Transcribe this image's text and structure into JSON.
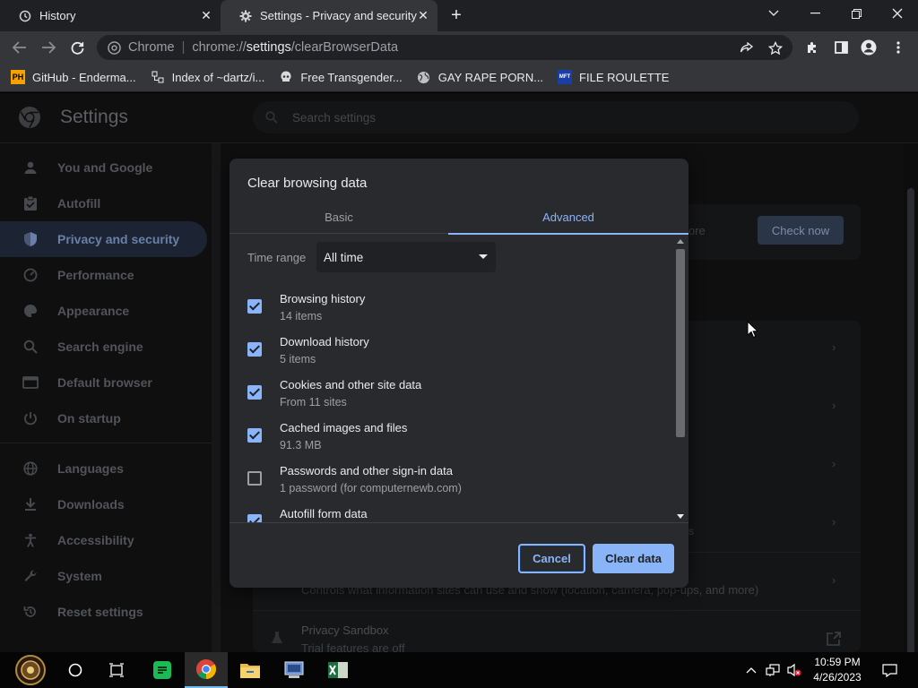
{
  "tabs": [
    {
      "title": "History",
      "icon": "history-icon"
    },
    {
      "title": "Settings - Privacy and security",
      "icon": "gear-icon"
    }
  ],
  "toolbar": {
    "site_chip": "Chrome",
    "url_scheme": "chrome://",
    "url_host": "settings",
    "url_path": "/clearBrowserData"
  },
  "bookmarks": [
    {
      "label": "GitHub - Enderma...",
      "icon": "ph-icon",
      "icon_text": "PH"
    },
    {
      "label": "Index of ~dartz/i...",
      "icon": "folder-index-icon"
    },
    {
      "label": "Free Transgender...",
      "icon": "skull-icon"
    },
    {
      "label": "GAY RAPE PORN...",
      "icon": "globe-icon"
    },
    {
      "label": "FILE ROULETTE",
      "icon": "mft-icon",
      "icon_text": "MFT"
    }
  ],
  "settings": {
    "title": "Settings",
    "search_placeholder": "Search settings",
    "sidebar": [
      {
        "label": "You and Google",
        "icon": "person-icon"
      },
      {
        "label": "Autofill",
        "icon": "clipboard-icon"
      },
      {
        "label": "Privacy and security",
        "icon": "shield-icon",
        "active": true
      },
      {
        "label": "Performance",
        "icon": "speedometer-icon"
      },
      {
        "label": "Appearance",
        "icon": "palette-icon"
      },
      {
        "label": "Search engine",
        "icon": "search-icon"
      },
      {
        "label": "Default browser",
        "icon": "browser-icon"
      },
      {
        "label": "On startup",
        "icon": "power-icon"
      },
      {
        "label": "Languages",
        "icon": "globe-icon"
      },
      {
        "label": "Downloads",
        "icon": "download-icon"
      },
      {
        "label": "Accessibility",
        "icon": "accessibility-icon"
      },
      {
        "label": "System",
        "icon": "wrench-icon"
      },
      {
        "label": "Reset settings",
        "icon": "reset-icon"
      }
    ],
    "background": {
      "more_fragment": "ore",
      "check_now": "Check now",
      "site_settings_desc": "Controls what information sites can use and show (location, camera, pop-ups, and more)",
      "privacy_sandbox_title": "Privacy Sandbox",
      "privacy_sandbox_desc": "Trial features are off",
      "small_fragment": "s"
    }
  },
  "dialog": {
    "title": "Clear browsing data",
    "tabs": [
      "Basic",
      "Advanced"
    ],
    "active_tab": "Advanced",
    "time_range_label": "Time range",
    "time_range_value": "All time",
    "options": [
      {
        "title": "Browsing history",
        "subtitle": "14 items",
        "checked": true
      },
      {
        "title": "Download history",
        "subtitle": "5 items",
        "checked": true
      },
      {
        "title": "Cookies and other site data",
        "subtitle": "From 11 sites",
        "checked": true
      },
      {
        "title": "Cached images and files",
        "subtitle": "91.3 MB",
        "checked": true
      },
      {
        "title": "Passwords and other sign-in data",
        "subtitle": "1 password (for computernewb.com)",
        "checked": false
      },
      {
        "title": "Autofill form data",
        "subtitle": "",
        "checked": true
      }
    ],
    "cancel_label": "Cancel",
    "clear_label": "Clear data"
  },
  "taskbar": {
    "apps": [
      "start-icon",
      "cortana-icon",
      "task-view-icon",
      "spotify-green-icon",
      "chrome-icon",
      "file-explorer-icon",
      "app-icon",
      "excel-icon"
    ],
    "time": "10:59 PM",
    "date": "4/26/2023"
  },
  "colors": {
    "accent": "#8ab4f8",
    "dialog_bg": "#292a2d",
    "page_overlay": "#0f0f10"
  }
}
